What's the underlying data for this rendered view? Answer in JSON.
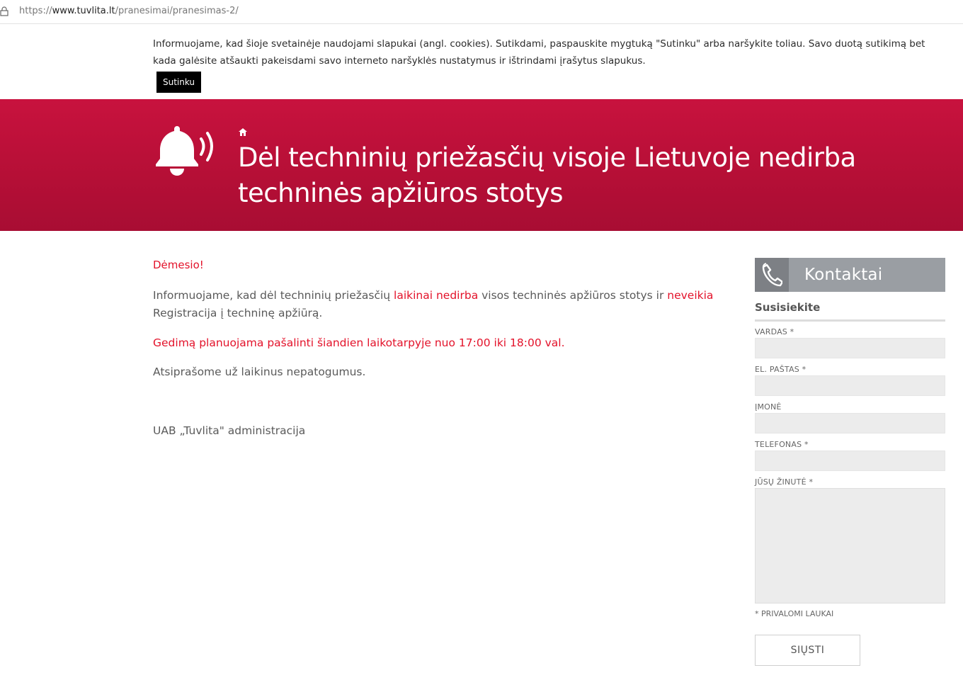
{
  "browser": {
    "url_prefix": "https://",
    "url_host": "www.tuvlita.lt",
    "url_path": "/pranesimai/pranesimas-2/"
  },
  "cookie_notice": {
    "text": "Informuojame, kad šioje svetainėje naudojami slapukai (angl. cookies). Sutikdami, paspauskite mygtuką \"Sutinku\" arba naršykite toliau. Savo duotą sutikimą bet kada galėsite atšaukti pakeisdami savo interneto naršyklės nustatymus ir ištrindami įrašytus slapukus.",
    "accept_label": "Sutinku"
  },
  "hero": {
    "title": "Dėl techninių priežasčių visoje Lietuvoje nedirba techninės apžiūros stotys",
    "icon": "bell-ringing-icon",
    "breadcrumb_icon": "home-icon"
  },
  "article": {
    "attention": "Dėmesio!",
    "p1_a": "Informuojame, kad dėl techninių priežasčių ",
    "p1_b": "laikinai nedirba",
    "p1_c": " visos techninės apžiūros stotys ir ",
    "p1_d": "neveikia",
    "p1_e": " Registracija į techninę apžiūrą.",
    "p2": "Gedimą planuojama pašalinti šiandien laikotarpyje nuo 17:00 iki 18:00 val.",
    "p3": "Atsiprašome už laikinus nepatogumus.",
    "p4": "UAB „Tuvlita\" administracija"
  },
  "sidebar": {
    "title": "Kontaktai",
    "icon": "phone-icon",
    "subtitle": "Susisiekite",
    "fields": {
      "name": "VARDAS *",
      "email": "EL. PAŠTAS *",
      "company": "ĮMONĖ",
      "phone": "TELEFONAS *",
      "message": "JŪSŲ ŽINUTĖ *"
    },
    "required_note": "* PRIVALOMI LAUKAI",
    "submit_label": "SIŲSTI"
  },
  "colors": {
    "brand_red": "#c8123e",
    "accent_red": "#e3122a",
    "sidebar_gray": "#9a9ea3"
  }
}
